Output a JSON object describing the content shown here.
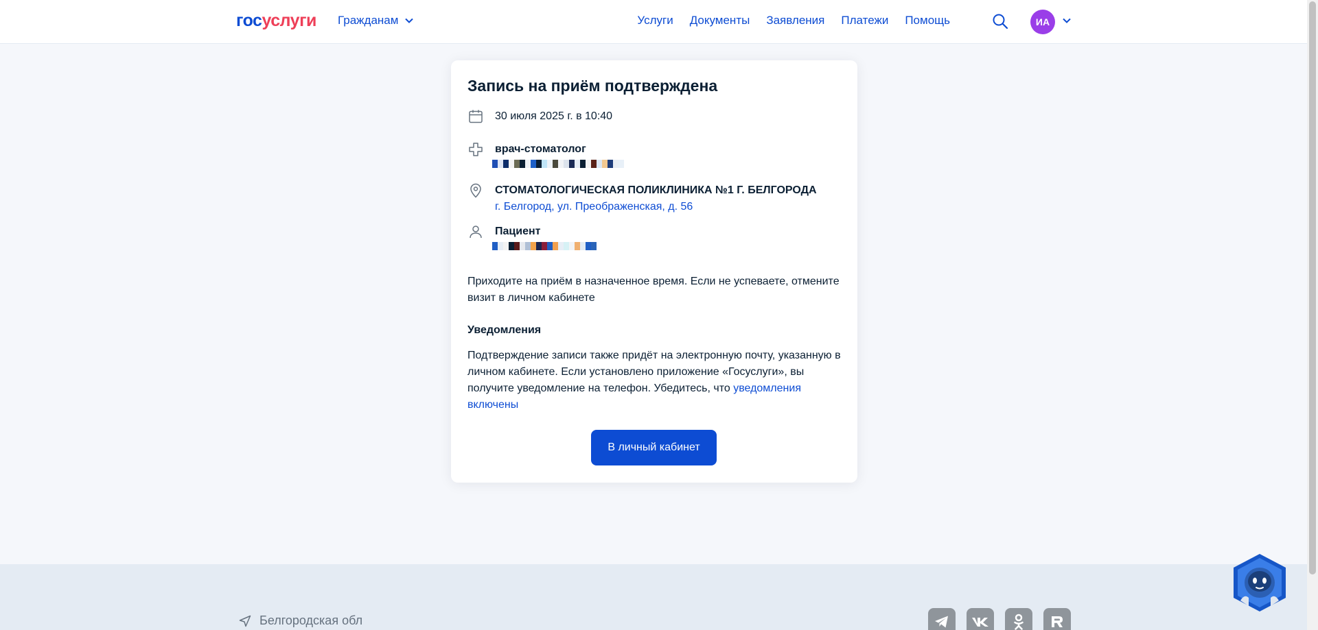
{
  "header": {
    "logo_part1": "гос",
    "logo_part2": "услуги",
    "citizens_label": "Гражданам",
    "nav": [
      "Услуги",
      "Документы",
      "Заявления",
      "Платежи",
      "Помощь"
    ],
    "avatar_initials": "ИА"
  },
  "card": {
    "title": "Запись на приём подтверждена",
    "datetime": "30 июля 2025 г. в 10:40",
    "doctor_specialty": "врач-стоматолог",
    "clinic_name": "СТОМАТОЛОГИЧЕСКАЯ ПОЛИКЛИНИКА №1 Г. БЕЛГОРОДА",
    "clinic_address": "г. Белгород, ул. Преображенская, д. 56",
    "patient_label": "Пациент",
    "info_text": "Приходите на приём в назначенное время. Если не успеваете, отмените визит в личном кабинете",
    "notifications_title": "Уведомления",
    "notifications_text": "Подтверждение записи также придёт на электронную почту, указанную в личном кабинете. Если установлено приложение «Госуслуги», вы получите уведомление на телефон. Убедитесь, что ",
    "notifications_link": "уведомления включены",
    "cabinet_button": "В личный кабинет"
  },
  "footer": {
    "region": "Белгородская обл",
    "socials": [
      "telegram-icon",
      "vk-icon",
      "odnoklassniki-icon",
      "rutube-icon"
    ]
  },
  "colors": {
    "brand_blue": "#0d4cd3",
    "brand_red": "#ee3f58",
    "avatar": "#9a3ee8",
    "background": "#f5f7fb"
  }
}
